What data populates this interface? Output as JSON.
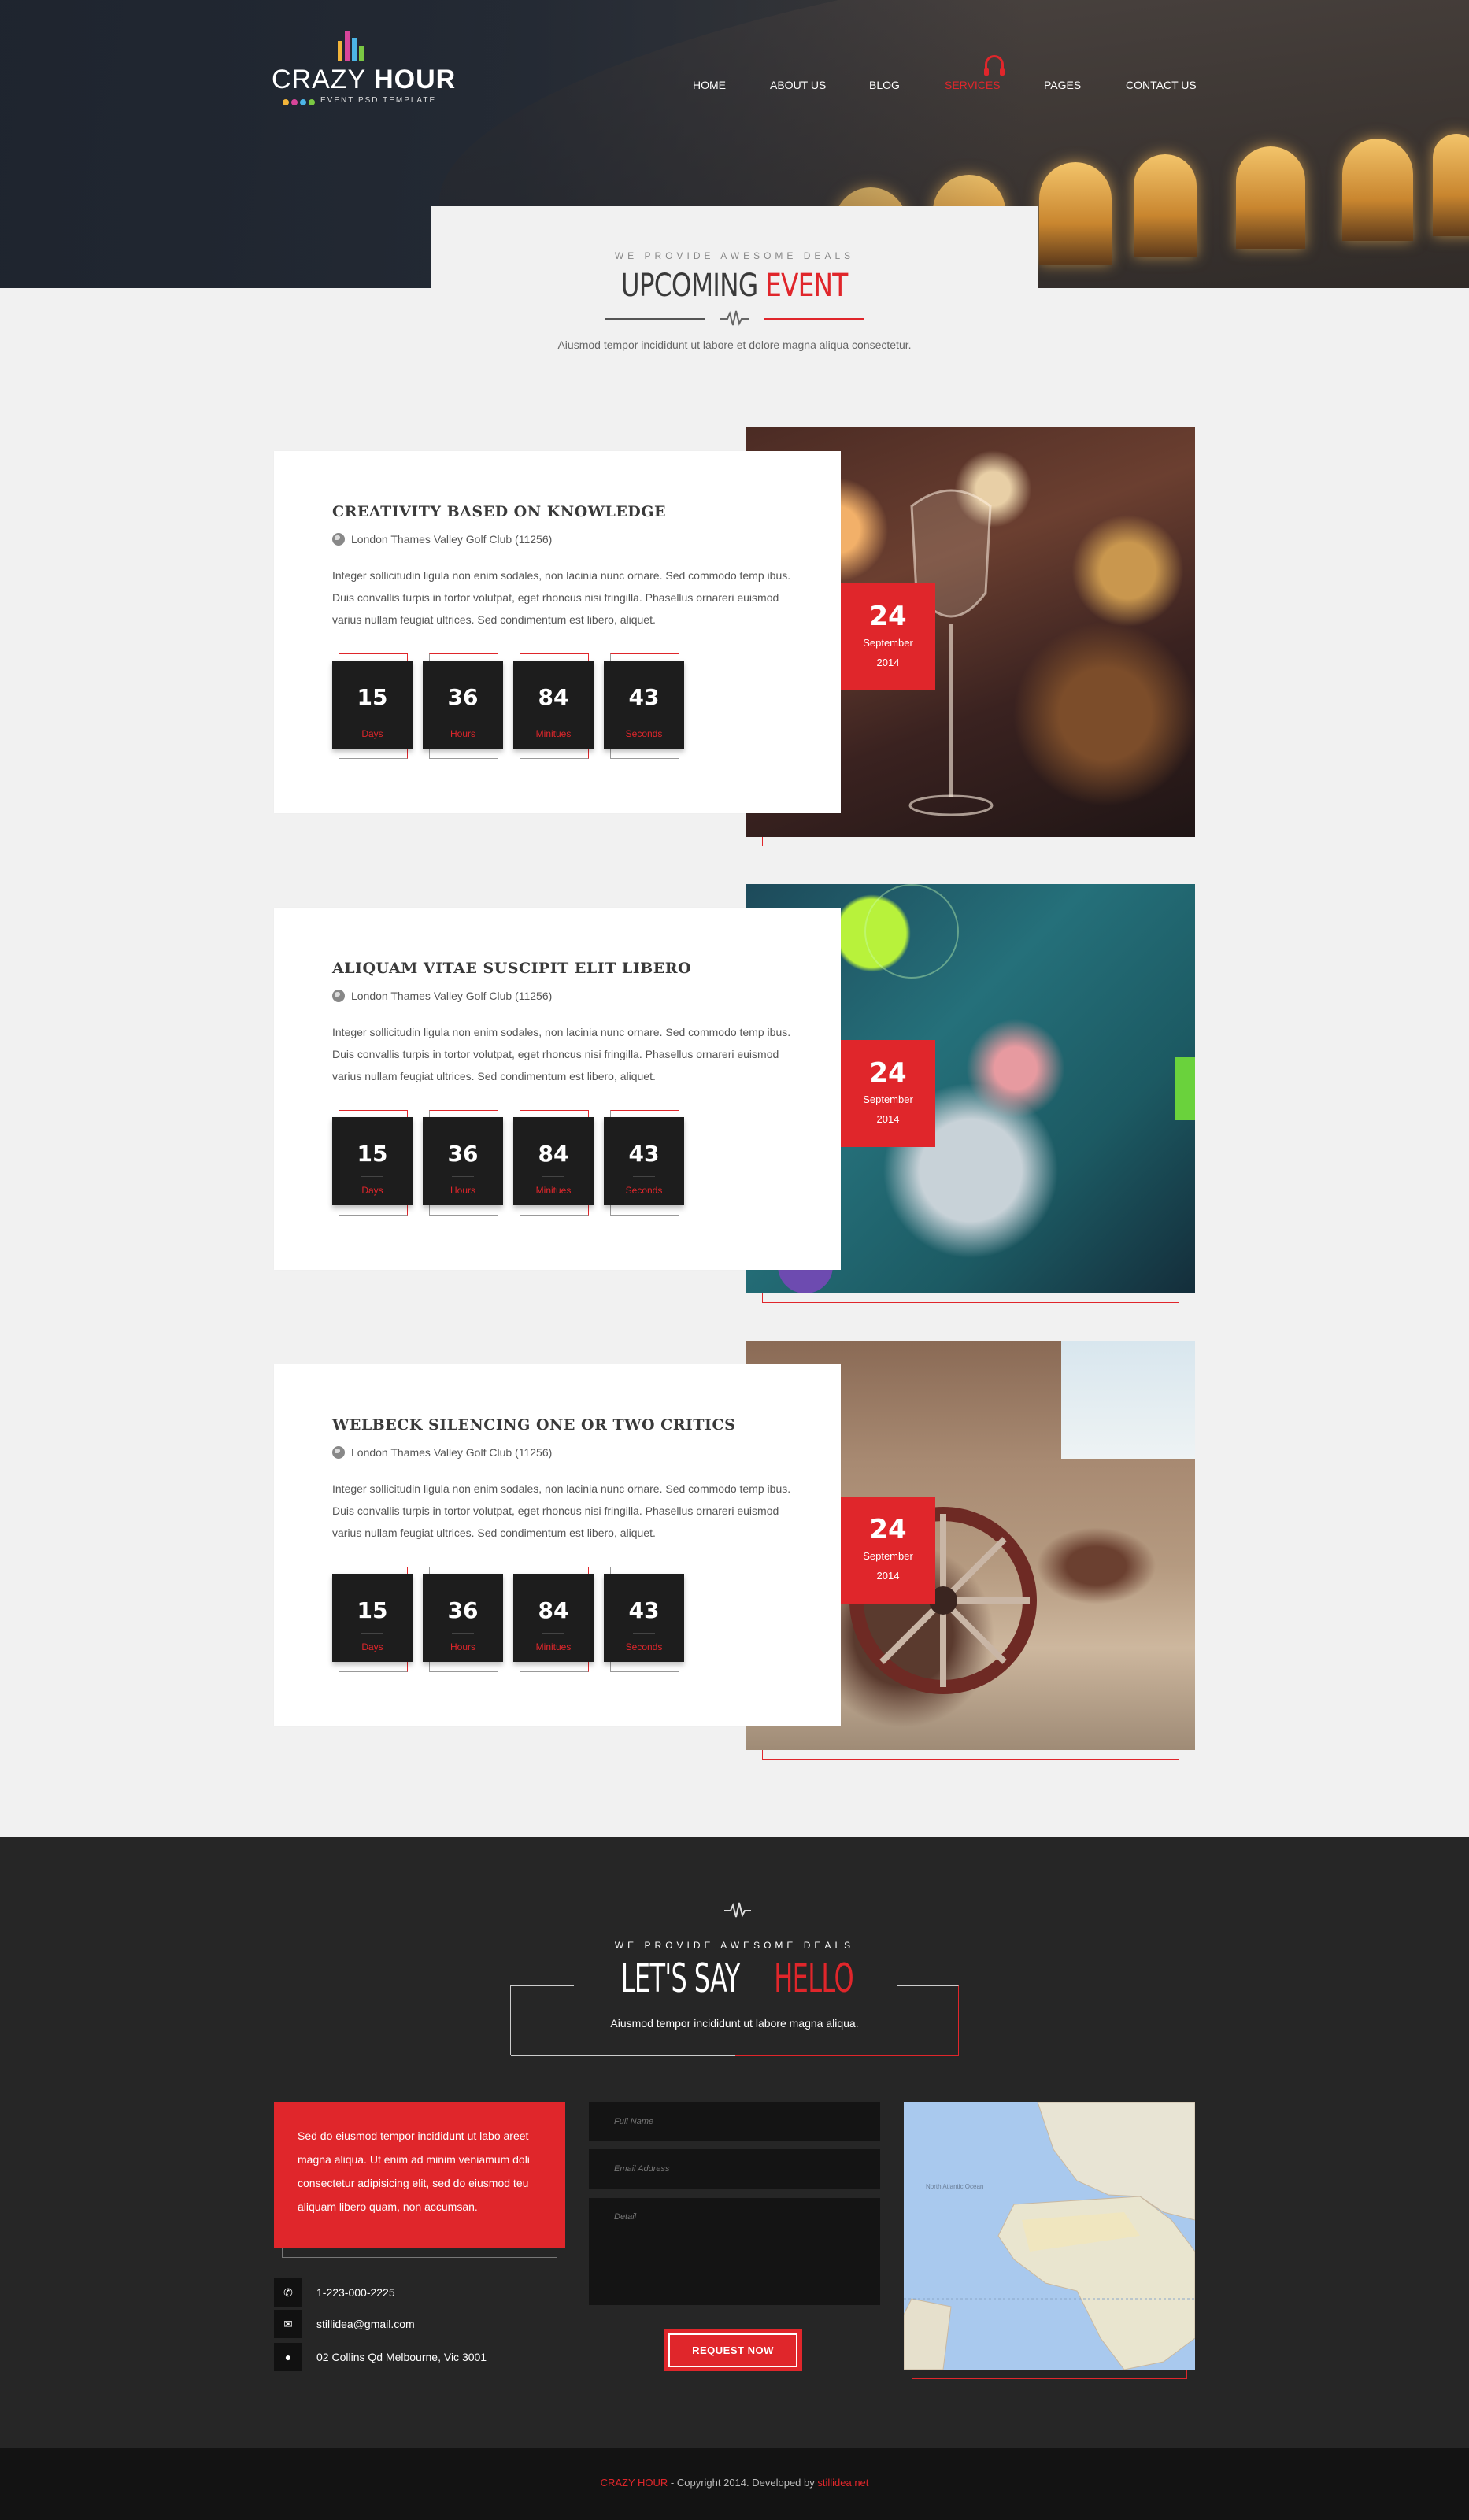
{
  "logo": {
    "light": "CRAZY",
    "bold": "HOUR",
    "tagline": "EVENT PSD TEMPLATE"
  },
  "nav": [
    {
      "label": "HOME",
      "active": false
    },
    {
      "label": "ABOUT US",
      "active": false
    },
    {
      "label": "BLOG",
      "active": false
    },
    {
      "label": "SERVICES",
      "active": true
    },
    {
      "label": "PAGES",
      "active": false
    },
    {
      "label": "CONTACT US",
      "active": false
    }
  ],
  "upcoming": {
    "kicker": "WE PROVIDE AWESOME DEALS",
    "title_dark": "UPCOMING",
    "title_red": "EVENT",
    "lead": "Aiusmod tempor incididunt ut labore et dolore magna aliqua consectetur."
  },
  "events": [
    {
      "title": "CREATIVITY BASED ON KNOWLEDGE",
      "location": "London Thames Valley Golf Club (11256)",
      "description": "Integer sollicitudin ligula non enim sodales, non lacinia nunc ornare. Sed commodo temp ibus. Duis convallis turpis in tortor volutpat, eget rhoncus nisi fringilla. Phasellus ornareri euismod varius nullam feugiat ultrices. Sed condimentum est libero, aliquet.",
      "counters": [
        {
          "value": "15",
          "unit": "Days"
        },
        {
          "value": "36",
          "unit": "Hours"
        },
        {
          "value": "84",
          "unit": "Minitues"
        },
        {
          "value": "43",
          "unit": "Seconds"
        }
      ],
      "date": {
        "day": "24",
        "month": "September",
        "year": "2014"
      }
    },
    {
      "title": "ALIQUAM VITAE SUSCIPIT ELIT LIBERO",
      "location": "London Thames Valley Golf Club (11256)",
      "description": "Integer sollicitudin ligula non enim sodales, non lacinia nunc ornare. Sed commodo temp ibus. Duis convallis turpis in tortor volutpat, eget rhoncus nisi fringilla. Phasellus ornareri euismod varius nullam feugiat ultrices. Sed condimentum est libero, aliquet.",
      "counters": [
        {
          "value": "15",
          "unit": "Days"
        },
        {
          "value": "36",
          "unit": "Hours"
        },
        {
          "value": "84",
          "unit": "Minitues"
        },
        {
          "value": "43",
          "unit": "Seconds"
        }
      ],
      "date": {
        "day": "24",
        "month": "September",
        "year": "2014"
      }
    },
    {
      "title": "WELBECK SILENCING ONE OR TWO CRITICS",
      "location": "London Thames Valley Golf Club (11256)",
      "description": "Integer sollicitudin ligula non enim sodales, non lacinia nunc ornare. Sed commodo temp ibus. Duis convallis turpis in tortor volutpat, eget rhoncus nisi fringilla. Phasellus ornareri euismod varius nullam feugiat ultrices. Sed condimentum est libero, aliquet.",
      "counters": [
        {
          "value": "15",
          "unit": "Days"
        },
        {
          "value": "36",
          "unit": "Hours"
        },
        {
          "value": "84",
          "unit": "Minitues"
        },
        {
          "value": "43",
          "unit": "Seconds"
        }
      ],
      "date": {
        "day": "24",
        "month": "September",
        "year": "2014"
      }
    }
  ],
  "contact": {
    "kicker": "WE PROVIDE AWESOME DEALS",
    "title_light": "LET'S SAY",
    "title_red": "HELLO",
    "lead": "Aiusmod tempor incididunt ut labore magna aliqua.",
    "red_box": "Sed do eiusmod tempor incididunt ut labo areet magna aliqua. Ut enim ad minim veniamum doli consectetur adipisicing elit, sed do eiusmod teu aliquam libero quam, non accumsan.",
    "phone": "1-223-000-2225",
    "email": "stillidea@gmail.com",
    "address": "02 Collins Qd Melbourne, Vic 3001",
    "form": {
      "name_placeholder": "Full Name",
      "email_placeholder": "Email Address",
      "detail_placeholder": "Detail",
      "submit": "REQUEST NOW"
    },
    "map_labels": {
      "ocean": "North Atlantic Ocean"
    }
  },
  "footer": {
    "brand": "CRAZY HOUR",
    "copyright": " - Copyright 2014. Developed by ",
    "developer": "stillidea.net"
  },
  "colors": {
    "accent": "#e0262b",
    "dark": "#262626",
    "footer": "#131313",
    "page": "#f1f1f1"
  }
}
